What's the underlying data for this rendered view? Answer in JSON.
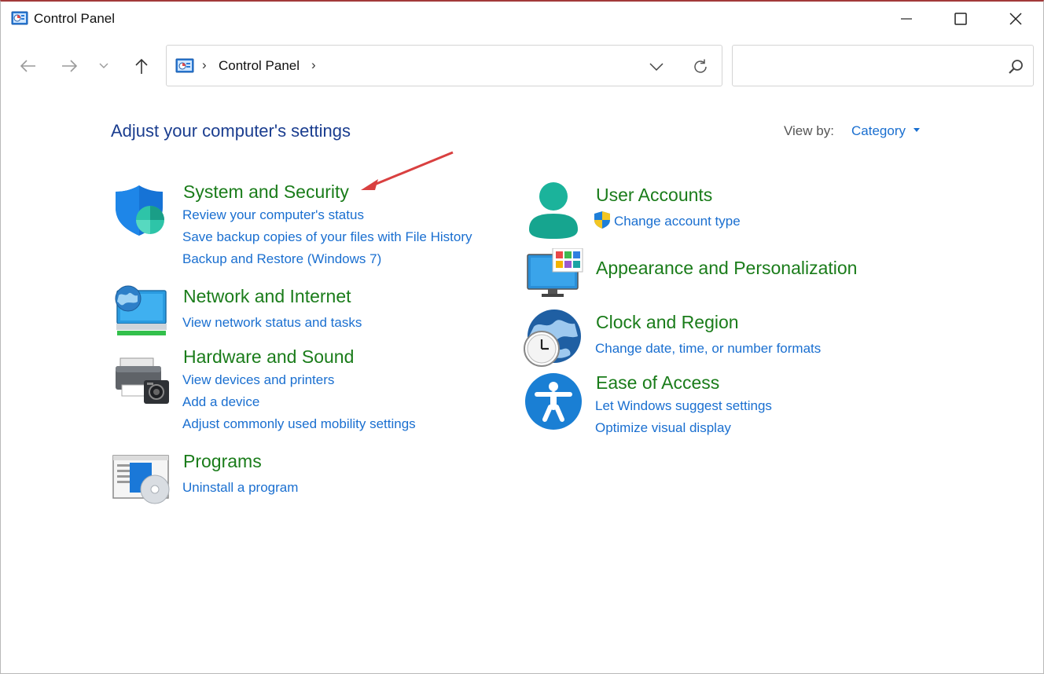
{
  "window": {
    "title": "Control Panel",
    "minimize_icon": "minimize-icon",
    "maximize_icon": "maximize-icon",
    "close_icon": "close-icon",
    "accent": "#a23a3a"
  },
  "navigation": {
    "back_icon": "back-arrow-icon",
    "forward_icon": "forward-arrow-icon",
    "recent_icon": "chevron-down-icon",
    "up_icon": "up-arrow-icon",
    "address": {
      "location_icon": "control-panel-icon",
      "path": "Control Panel",
      "dropdown_icon": "chevron-down-icon",
      "refresh_icon": "refresh-icon"
    },
    "search": {
      "placeholder": "",
      "icon": "search-icon"
    }
  },
  "content": {
    "heading": "Adjust your computer's settings",
    "view_by": {
      "label": "View by:",
      "value": "Category"
    },
    "left_categories": [
      {
        "title": "System and Security",
        "icon": "shield-icon",
        "links": [
          "Review your computer's status",
          "Save backup copies of your files with File History",
          "Backup and Restore (Windows 7)"
        ]
      },
      {
        "title": "Network and Internet",
        "icon": "network-globe-icon",
        "links": [
          "View network status and tasks"
        ]
      },
      {
        "title": "Hardware and Sound",
        "icon": "printer-icon",
        "links": [
          "View devices and printers",
          "Add a device",
          "Adjust commonly used mobility settings"
        ]
      },
      {
        "title": "Programs",
        "icon": "programs-disc-icon",
        "links": [
          "Uninstall a program"
        ]
      }
    ],
    "right_categories": [
      {
        "title": "User Accounts",
        "icon": "user-icon",
        "links": [
          "Change account type"
        ],
        "link_icon": "uac-shield-icon"
      },
      {
        "title": "Appearance and Personalization",
        "icon": "monitor-icon",
        "links": []
      },
      {
        "title": "Clock and Region",
        "icon": "globe-clock-icon",
        "links": [
          "Change date, time, or number formats"
        ]
      },
      {
        "title": "Ease of Access",
        "icon": "accessibility-icon",
        "links": [
          "Let Windows suggest settings",
          "Optimize visual display"
        ]
      }
    ]
  },
  "colors": {
    "heading": "#1a3d8f",
    "category_title": "#1a7c1a",
    "link": "#1a6fd0",
    "annotation_arrow": "#d94040"
  }
}
